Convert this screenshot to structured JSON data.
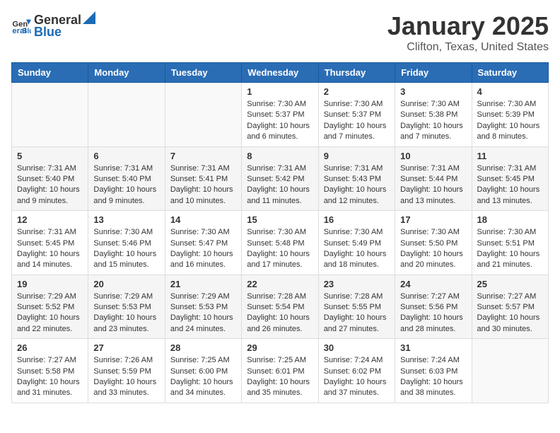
{
  "header": {
    "logo_general": "General",
    "logo_blue": "Blue",
    "month_title": "January 2025",
    "location": "Clifton, Texas, United States"
  },
  "days_of_week": [
    "Sunday",
    "Monday",
    "Tuesday",
    "Wednesday",
    "Thursday",
    "Friday",
    "Saturday"
  ],
  "weeks": [
    [
      {
        "day": "",
        "sunrise": "",
        "sunset": "",
        "daylight": ""
      },
      {
        "day": "",
        "sunrise": "",
        "sunset": "",
        "daylight": ""
      },
      {
        "day": "",
        "sunrise": "",
        "sunset": "",
        "daylight": ""
      },
      {
        "day": "1",
        "sunrise": "Sunrise: 7:30 AM",
        "sunset": "Sunset: 5:37 PM",
        "daylight": "Daylight: 10 hours and 6 minutes."
      },
      {
        "day": "2",
        "sunrise": "Sunrise: 7:30 AM",
        "sunset": "Sunset: 5:37 PM",
        "daylight": "Daylight: 10 hours and 7 minutes."
      },
      {
        "day": "3",
        "sunrise": "Sunrise: 7:30 AM",
        "sunset": "Sunset: 5:38 PM",
        "daylight": "Daylight: 10 hours and 7 minutes."
      },
      {
        "day": "4",
        "sunrise": "Sunrise: 7:30 AM",
        "sunset": "Sunset: 5:39 PM",
        "daylight": "Daylight: 10 hours and 8 minutes."
      }
    ],
    [
      {
        "day": "5",
        "sunrise": "Sunrise: 7:31 AM",
        "sunset": "Sunset: 5:40 PM",
        "daylight": "Daylight: 10 hours and 9 minutes."
      },
      {
        "day": "6",
        "sunrise": "Sunrise: 7:31 AM",
        "sunset": "Sunset: 5:40 PM",
        "daylight": "Daylight: 10 hours and 9 minutes."
      },
      {
        "day": "7",
        "sunrise": "Sunrise: 7:31 AM",
        "sunset": "Sunset: 5:41 PM",
        "daylight": "Daylight: 10 hours and 10 minutes."
      },
      {
        "day": "8",
        "sunrise": "Sunrise: 7:31 AM",
        "sunset": "Sunset: 5:42 PM",
        "daylight": "Daylight: 10 hours and 11 minutes."
      },
      {
        "day": "9",
        "sunrise": "Sunrise: 7:31 AM",
        "sunset": "Sunset: 5:43 PM",
        "daylight": "Daylight: 10 hours and 12 minutes."
      },
      {
        "day": "10",
        "sunrise": "Sunrise: 7:31 AM",
        "sunset": "Sunset: 5:44 PM",
        "daylight": "Daylight: 10 hours and 13 minutes."
      },
      {
        "day": "11",
        "sunrise": "Sunrise: 7:31 AM",
        "sunset": "Sunset: 5:45 PM",
        "daylight": "Daylight: 10 hours and 13 minutes."
      }
    ],
    [
      {
        "day": "12",
        "sunrise": "Sunrise: 7:31 AM",
        "sunset": "Sunset: 5:45 PM",
        "daylight": "Daylight: 10 hours and 14 minutes."
      },
      {
        "day": "13",
        "sunrise": "Sunrise: 7:30 AM",
        "sunset": "Sunset: 5:46 PM",
        "daylight": "Daylight: 10 hours and 15 minutes."
      },
      {
        "day": "14",
        "sunrise": "Sunrise: 7:30 AM",
        "sunset": "Sunset: 5:47 PM",
        "daylight": "Daylight: 10 hours and 16 minutes."
      },
      {
        "day": "15",
        "sunrise": "Sunrise: 7:30 AM",
        "sunset": "Sunset: 5:48 PM",
        "daylight": "Daylight: 10 hours and 17 minutes."
      },
      {
        "day": "16",
        "sunrise": "Sunrise: 7:30 AM",
        "sunset": "Sunset: 5:49 PM",
        "daylight": "Daylight: 10 hours and 18 minutes."
      },
      {
        "day": "17",
        "sunrise": "Sunrise: 7:30 AM",
        "sunset": "Sunset: 5:50 PM",
        "daylight": "Daylight: 10 hours and 20 minutes."
      },
      {
        "day": "18",
        "sunrise": "Sunrise: 7:30 AM",
        "sunset": "Sunset: 5:51 PM",
        "daylight": "Daylight: 10 hours and 21 minutes."
      }
    ],
    [
      {
        "day": "19",
        "sunrise": "Sunrise: 7:29 AM",
        "sunset": "Sunset: 5:52 PM",
        "daylight": "Daylight: 10 hours and 22 minutes."
      },
      {
        "day": "20",
        "sunrise": "Sunrise: 7:29 AM",
        "sunset": "Sunset: 5:53 PM",
        "daylight": "Daylight: 10 hours and 23 minutes."
      },
      {
        "day": "21",
        "sunrise": "Sunrise: 7:29 AM",
        "sunset": "Sunset: 5:53 PM",
        "daylight": "Daylight: 10 hours and 24 minutes."
      },
      {
        "day": "22",
        "sunrise": "Sunrise: 7:28 AM",
        "sunset": "Sunset: 5:54 PM",
        "daylight": "Daylight: 10 hours and 26 minutes."
      },
      {
        "day": "23",
        "sunrise": "Sunrise: 7:28 AM",
        "sunset": "Sunset: 5:55 PM",
        "daylight": "Daylight: 10 hours and 27 minutes."
      },
      {
        "day": "24",
        "sunrise": "Sunrise: 7:27 AM",
        "sunset": "Sunset: 5:56 PM",
        "daylight": "Daylight: 10 hours and 28 minutes."
      },
      {
        "day": "25",
        "sunrise": "Sunrise: 7:27 AM",
        "sunset": "Sunset: 5:57 PM",
        "daylight": "Daylight: 10 hours and 30 minutes."
      }
    ],
    [
      {
        "day": "26",
        "sunrise": "Sunrise: 7:27 AM",
        "sunset": "Sunset: 5:58 PM",
        "daylight": "Daylight: 10 hours and 31 minutes."
      },
      {
        "day": "27",
        "sunrise": "Sunrise: 7:26 AM",
        "sunset": "Sunset: 5:59 PM",
        "daylight": "Daylight: 10 hours and 33 minutes."
      },
      {
        "day": "28",
        "sunrise": "Sunrise: 7:25 AM",
        "sunset": "Sunset: 6:00 PM",
        "daylight": "Daylight: 10 hours and 34 minutes."
      },
      {
        "day": "29",
        "sunrise": "Sunrise: 7:25 AM",
        "sunset": "Sunset: 6:01 PM",
        "daylight": "Daylight: 10 hours and 35 minutes."
      },
      {
        "day": "30",
        "sunrise": "Sunrise: 7:24 AM",
        "sunset": "Sunset: 6:02 PM",
        "daylight": "Daylight: 10 hours and 37 minutes."
      },
      {
        "day": "31",
        "sunrise": "Sunrise: 7:24 AM",
        "sunset": "Sunset: 6:03 PM",
        "daylight": "Daylight: 10 hours and 38 minutes."
      },
      {
        "day": "",
        "sunrise": "",
        "sunset": "",
        "daylight": ""
      }
    ]
  ]
}
